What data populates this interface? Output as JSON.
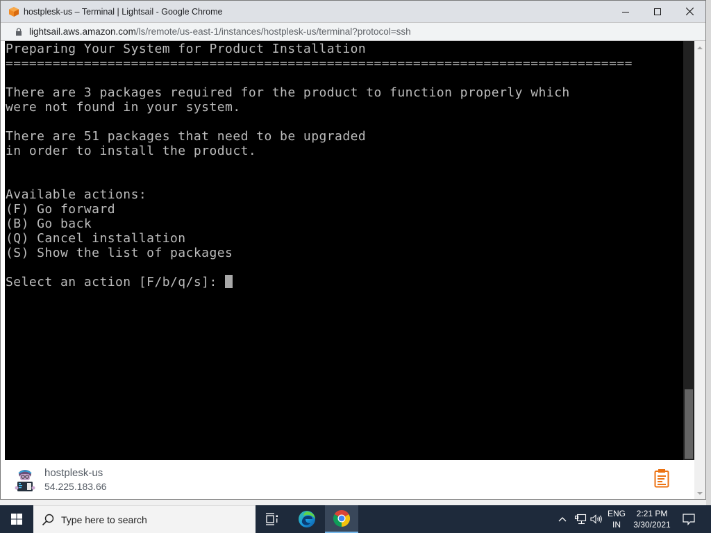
{
  "browser": {
    "window_title": "hostplesk-us – Terminal | Lightsail - Google Chrome",
    "url_host": "lightsail.aws.amazon.com",
    "url_path": "/ls/remote/us-east-1/instances/hostplesk-us/terminal?protocol=ssh",
    "controls": {
      "minimize": "minimize",
      "maximize": "maximize",
      "close": "close"
    }
  },
  "terminal": {
    "lines": [
      "Preparing Your System for Product Installation",
      "================================================================================",
      "",
      "There are 3 packages required for the product to function properly which",
      "were not found in your system.",
      "",
      "There are 51 packages that need to be upgraded",
      "in order to install the product.",
      "",
      "",
      "Available actions:",
      "(F) Go forward",
      "(B) Go back",
      "(Q) Cancel installation",
      "(S) Show the list of packages",
      ""
    ],
    "prompt": "Select an action [F/b/q/s]: ",
    "input_value": ""
  },
  "footer": {
    "instance_name": "hostplesk-us",
    "instance_ip": "54.225.183.66",
    "clipboard_icon": "clipboard-icon"
  },
  "colors": {
    "accent": "#ec7211",
    "terminal_bg": "#000000",
    "terminal_fg": "#bcbcbc",
    "taskbar_bg": "#1e2a3b"
  },
  "taskbar": {
    "search_placeholder": "Type here to search",
    "language_line1": "ENG",
    "language_line2": "IN",
    "time": "2:21 PM",
    "date": "3/30/2021"
  }
}
